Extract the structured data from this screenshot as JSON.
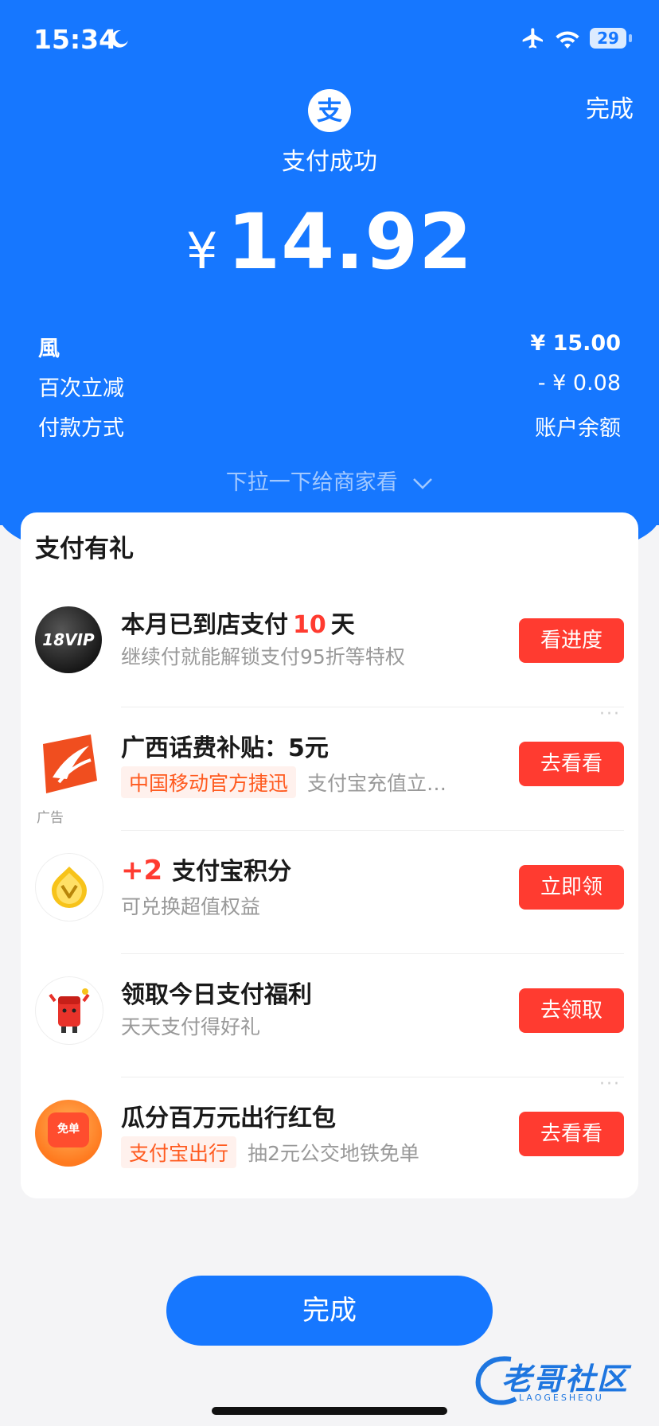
{
  "status_bar": {
    "time": "15:34",
    "battery": "29"
  },
  "header": {
    "done_link": "完成",
    "logo_char": "支",
    "status": "支付成功",
    "currency": "¥",
    "amount": "14.92"
  },
  "details": [
    {
      "label": "風",
      "value": "¥ 15.00"
    },
    {
      "label": "百次立减",
      "value": "- ¥ 0.08"
    },
    {
      "label": "付款方式",
      "value": "账户余额"
    }
  ],
  "pull_hint": "下拉一下给商家看",
  "rewards": {
    "title": "支付有礼",
    "items": [
      {
        "title_pre": "本月已到店支付",
        "title_hl": "10",
        "title_post": "天",
        "subtitle": "继续付就能解锁支付95折等特权",
        "button": "看进度",
        "icon": "vip-18-icon",
        "icon_text": "18VIP"
      },
      {
        "title": "广西话费补贴：5元",
        "tag": "中国移动官方捷迅",
        "subtitle": "支付宝充值立…",
        "button": "去看看",
        "icon": "china-mobile-icon",
        "ad_label": "广告"
      },
      {
        "title_hl": "+2",
        "title_post": "支付宝积分",
        "subtitle": "可兑换超值权益",
        "button": "立即领",
        "icon": "points-coin-icon"
      },
      {
        "title": "领取今日支付福利",
        "subtitle": "天天支付得好礼",
        "button": "去领取",
        "icon": "red-envelope-icon"
      },
      {
        "title": "瓜分百万元出行红包",
        "tag": "支付宝出行",
        "subtitle": "抽2元公交地铁免单",
        "button": "去看看",
        "icon": "travel-voucher-icon",
        "icon_text": "免单"
      }
    ]
  },
  "done_button": "完成",
  "watermark": {
    "text": "老哥社区",
    "sub": "LAOGESHEQU"
  },
  "colors": {
    "brand_blue": "#1677ff",
    "action_red": "#ff3b30",
    "tag_orange": "#ff5a1f"
  }
}
